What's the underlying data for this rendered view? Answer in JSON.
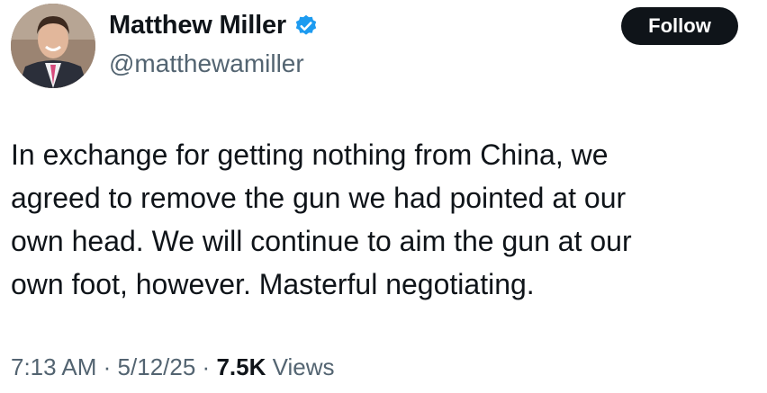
{
  "author": {
    "name": "Matthew Miller",
    "handle": "@matthewamiller",
    "verified_color": "#1d9bf0"
  },
  "follow_button": {
    "label": "Follow"
  },
  "tweet": {
    "lines": [
      "In exchange for getting nothing from China, we",
      "agreed to remove the gun we had pointed at our",
      "own head. We will continue to aim the gun at our",
      "own foot, however. Masterful negotiating."
    ]
  },
  "meta": {
    "time": "7:13 AM",
    "separator": "·",
    "date": "5/12/25",
    "views_count": "7.5K",
    "views_label": "Views"
  }
}
